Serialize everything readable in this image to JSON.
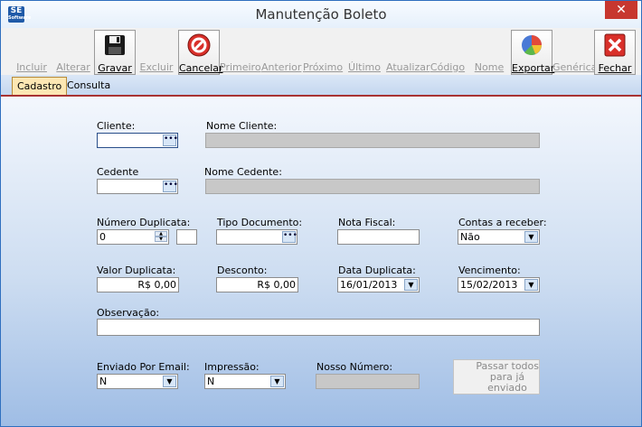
{
  "window": {
    "title": "Manutenção Boleto",
    "app_icon_text": "SE",
    "app_icon_sub": "Software",
    "close_glyph": "✕"
  },
  "toolbar": {
    "buttons": [
      {
        "label": "Incluir",
        "enabled": false
      },
      {
        "label": "Alterar",
        "enabled": false
      },
      {
        "label": "Gravar",
        "enabled": true,
        "icon": "floppy-disk-icon"
      },
      {
        "label": "Excluir",
        "enabled": false
      },
      {
        "label": "Cancelar",
        "enabled": true,
        "icon": "cancel-icon"
      },
      {
        "label": "Primeiro",
        "enabled": false
      },
      {
        "label": "Anterior",
        "enabled": false
      },
      {
        "label": "Próximo",
        "enabled": false
      },
      {
        "label": "Último",
        "enabled": false
      },
      {
        "label": "Atualizar",
        "enabled": false
      },
      {
        "label": "Código",
        "enabled": false
      },
      {
        "label": "Nome",
        "enabled": false
      },
      {
        "label": "Exportar",
        "enabled": true,
        "icon": "pie-chart-icon"
      },
      {
        "label": "Genérica",
        "enabled": false
      },
      {
        "label": "Fechar",
        "enabled": true,
        "icon": "close-x-icon"
      }
    ]
  },
  "tabs": [
    {
      "label": "Cadastro",
      "active": true
    },
    {
      "label": "Consulta",
      "active": false
    }
  ],
  "form": {
    "cliente_label": "Cliente:",
    "cliente_value": "",
    "nome_cliente_label": "Nome Cliente:",
    "nome_cliente_value": "",
    "cedente_label": "Cedente",
    "cedente_value": "",
    "nome_cedente_label": "Nome Cedente:",
    "nome_cedente_value": "",
    "numero_duplicata_label": "Número Duplicata:",
    "numero_duplicata_value": "0",
    "numero_duplicata_suffix": "",
    "tipo_documento_label": "Tipo Documento:",
    "tipo_documento_value": "",
    "nota_fiscal_label": "Nota Fiscal:",
    "nota_fiscal_value": "",
    "contas_receber_label": "Contas a receber:",
    "contas_receber_value": "Não",
    "valor_duplicata_label": "Valor Duplicata:",
    "valor_duplicata_value": "R$ 0,00",
    "desconto_label": "Desconto:",
    "desconto_value": "R$ 0,00",
    "data_duplicata_label": "Data Duplicata:",
    "data_duplicata_value": "16/01/2013",
    "vencimento_label": "Vencimento:",
    "vencimento_value": "15/02/2013",
    "observacao_label": "Observação:",
    "observacao_value": "",
    "enviado_email_label": "Enviado Por Email:",
    "enviado_email_value": "N",
    "impressao_label": "Impressão:",
    "impressao_value": "N",
    "nosso_numero_label": "Nosso Número:",
    "nosso_numero_value": "",
    "passar_todos_line1": "Passar todos",
    "passar_todos_line2": "para já",
    "passar_todos_line3": "enviado"
  },
  "glyphs": {
    "ellipsis": "•••",
    "dropdown": "▼",
    "spin_up": "▲",
    "spin_down": "▼"
  },
  "colors": {
    "title_bar": "#e6f0fb",
    "close": "#c7372f",
    "tab_active": "#fde7b3",
    "tab_underline": "#a83232"
  }
}
